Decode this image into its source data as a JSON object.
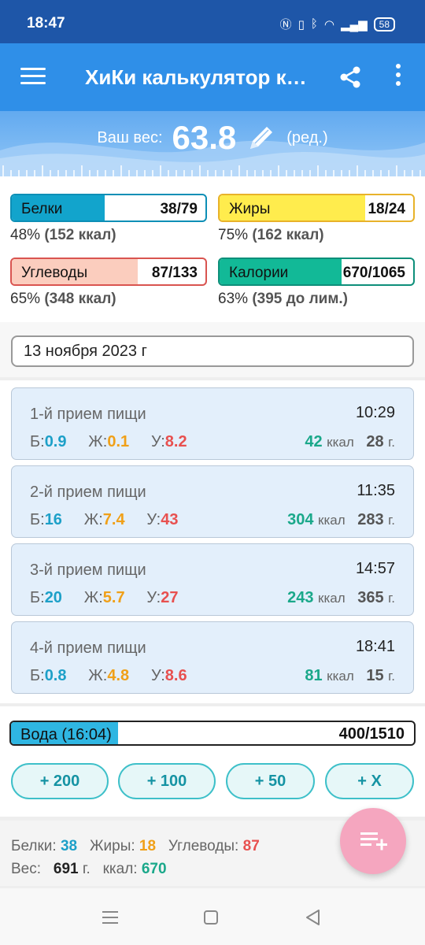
{
  "status_bar": {
    "time": "18:47",
    "battery": "58"
  },
  "app_bar": {
    "title": "ХиКи калькулятор калорий"
  },
  "weight": {
    "label": "Ваш вес:",
    "value": "63.8",
    "edit_label": "(ред.)"
  },
  "macros": [
    {
      "name": "Белки",
      "value": "38/79",
      "fill_fraction": 0.48,
      "fill_color": "#12a4cc",
      "border_color": "#0d8fb6",
      "percent": "48%",
      "detail": "(152 ккал)"
    },
    {
      "name": "Жиры",
      "value": "18/24",
      "fill_fraction": 0.75,
      "fill_color": "#ffec4d",
      "border_color": "#e8b22a",
      "percent": "75%",
      "detail": "(162 ккал)"
    },
    {
      "name": "Углеводы",
      "value": "87/133",
      "fill_fraction": 0.65,
      "fill_color": "#fbcdbe",
      "border_color": "#d95450",
      "percent": "65%",
      "detail": "(348 ккал)"
    },
    {
      "name": "Калории",
      "value": "670/1065",
      "fill_fraction": 0.63,
      "fill_color": "#12b997",
      "border_color": "#0e8f7a",
      "percent": "63%",
      "detail": "(395 до лим.)"
    }
  ],
  "date": "13 ноября 2023 г",
  "meals": [
    {
      "name": "1-й прием пищи",
      "time": "10:29",
      "b": "0.9",
      "zh": "0.1",
      "u": "8.2",
      "kcal": "42",
      "grams": "28"
    },
    {
      "name": "2-й прием пищи",
      "time": "11:35",
      "b": "16",
      "zh": "7.4",
      "u": "43",
      "kcal": "304",
      "grams": "283"
    },
    {
      "name": "3-й прием пищи",
      "time": "14:57",
      "b": "20",
      "zh": "5.7",
      "u": "27",
      "kcal": "243",
      "grams": "365"
    },
    {
      "name": "4-й прием пищи",
      "time": "18:41",
      "b": "0.8",
      "zh": "4.8",
      "u": "8.6",
      "kcal": "81",
      "grams": "15"
    }
  ],
  "meal_labels": {
    "b": "Б:",
    "zh": "Ж:",
    "u": "У:",
    "kcal_unit": "ккал",
    "grams_unit": "г."
  },
  "water": {
    "label": "Вода (16:04)",
    "value": "400/1510",
    "fill_fraction": 0.265,
    "buttons": [
      "+ 200",
      "+ 100",
      "+ 50",
      "+ X"
    ]
  },
  "summary": {
    "protein_label": "Белки:",
    "protein": "38",
    "fat_label": "Жиры:",
    "fat": "18",
    "carbs_label": "Углеводы:",
    "carbs": "87",
    "weight_label": "Вес:",
    "weight": "691",
    "weight_unit": "г.",
    "kcal_label": "ккал:",
    "kcal": "670"
  },
  "colors": {
    "app_bar": "#2f8fe8",
    "status_bar": "#1e56a8",
    "fab": "#f5a6bf",
    "protein": "#1da0c8",
    "fat": "#f0a018",
    "carbs": "#e8504f",
    "kcal": "#1aa88a"
  },
  "icons": {
    "menu": "menu-icon",
    "share": "share-icon",
    "more": "more-vert-icon",
    "edit": "pencil-icon",
    "fab": "add-to-list-icon"
  }
}
